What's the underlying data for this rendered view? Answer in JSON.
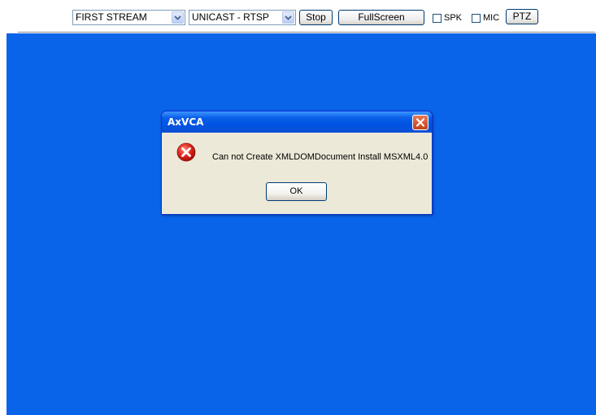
{
  "toolbar": {
    "stream_select": "FIRST STREAM",
    "protocol_select": "UNICAST - RTSP",
    "stop_label": "Stop",
    "fullscreen_label": "FullScreen",
    "spk_label": "SPK",
    "mic_label": "MIC",
    "ptz_label": "PTZ",
    "spk_checked": false,
    "mic_checked": false
  },
  "video": {
    "background": "#0a64ea"
  },
  "dialog": {
    "title": "AxVCA",
    "message": "Can not Create XMLDOMDocument Install MSXML4.0",
    "ok_label": "OK",
    "icon": "error-icon"
  }
}
